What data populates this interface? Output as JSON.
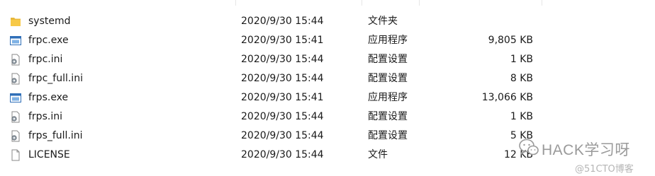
{
  "files": [
    {
      "name": "systemd",
      "modified": "2020/9/30 15:44",
      "type": "文件夹",
      "size": "",
      "icon": "folder-icon"
    },
    {
      "name": "frpc.exe",
      "modified": "2020/9/30 15:41",
      "type": "应用程序",
      "size": "9,805 KB",
      "icon": "exe-icon"
    },
    {
      "name": "frpc.ini",
      "modified": "2020/9/30 15:44",
      "type": "配置设置",
      "size": "1 KB",
      "icon": "config-file-icon"
    },
    {
      "name": "frpc_full.ini",
      "modified": "2020/9/30 15:44",
      "type": "配置设置",
      "size": "8 KB",
      "icon": "config-file-icon"
    },
    {
      "name": "frps.exe",
      "modified": "2020/9/30 15:41",
      "type": "应用程序",
      "size": "13,066 KB",
      "icon": "exe-icon"
    },
    {
      "name": "frps.ini",
      "modified": "2020/9/30 15:44",
      "type": "配置设置",
      "size": "1 KB",
      "icon": "config-file-icon"
    },
    {
      "name": "frps_full.ini",
      "modified": "2020/9/30 15:44",
      "type": "配置设置",
      "size": "5 KB",
      "icon": "config-file-icon"
    },
    {
      "name": "LICENSE",
      "modified": "2020/9/30 15:44",
      "type": "文件",
      "size": "12 KB",
      "icon": "blank-file-icon"
    }
  ],
  "watermark": {
    "main": "HACK学习呀",
    "sub": "@51CTO博客"
  },
  "colors": {
    "folder": "#f7c948",
    "exe_blue": "#2f6fb8",
    "watermark": "#9a9a9a"
  }
}
